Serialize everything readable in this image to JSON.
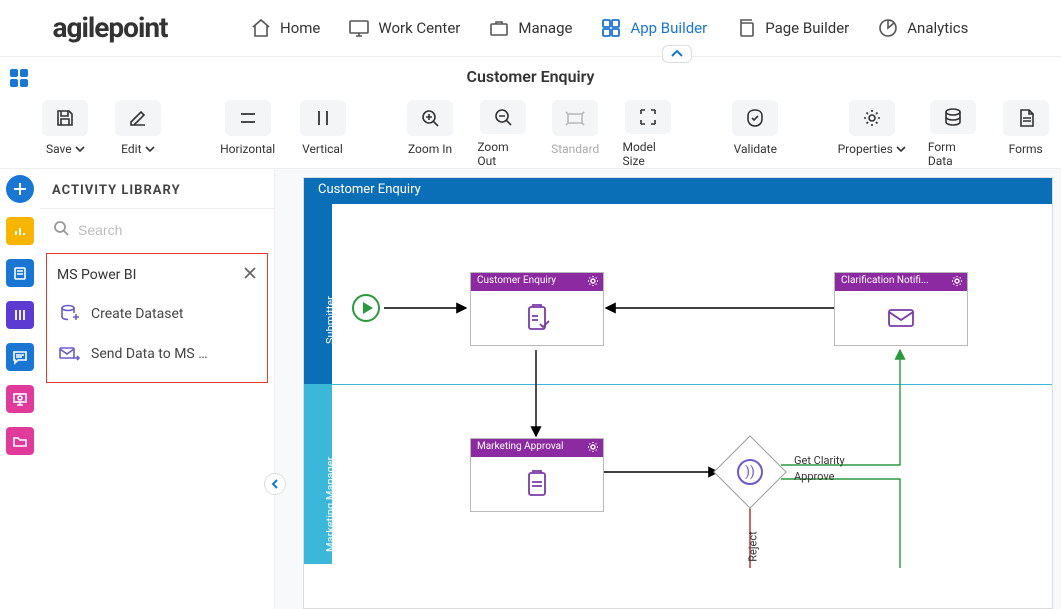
{
  "nav": {
    "logo": "agilepoint",
    "items": [
      {
        "label": "Home"
      },
      {
        "label": "Work Center"
      },
      {
        "label": "Manage"
      },
      {
        "label": "App Builder",
        "active": true
      },
      {
        "label": "Page Builder"
      },
      {
        "label": "Analytics"
      }
    ]
  },
  "page": {
    "title": "Customer Enquiry"
  },
  "toolbar": {
    "save": "Save",
    "edit": "Edit",
    "horizontal": "Horizontal",
    "vertical": "Vertical",
    "zoomin": "Zoom In",
    "zoomout": "Zoom Out",
    "standard": "Standard",
    "modelsize": "Model Size",
    "validate": "Validate",
    "properties": "Properties",
    "formdata": "Form Data",
    "forms": "Forms"
  },
  "library": {
    "title": "ACTIVITY LIBRARY",
    "search_placeholder": "Search",
    "group": "MS Power BI",
    "items": [
      {
        "label": "Create Dataset"
      },
      {
        "label": "Send Data to MS …"
      }
    ]
  },
  "canvas": {
    "title": "Customer Enquiry",
    "lane1": "Submitter",
    "lane2": "Marketing Manager",
    "nodes": {
      "customer_enquiry": "Customer Enquiry",
      "clarification": "Clarification Notifi...",
      "marketing_approval": "Marketing Approval"
    },
    "edges": {
      "get_clarity": "Get Clarity",
      "approve": "Approve",
      "reject": "Reject"
    }
  }
}
